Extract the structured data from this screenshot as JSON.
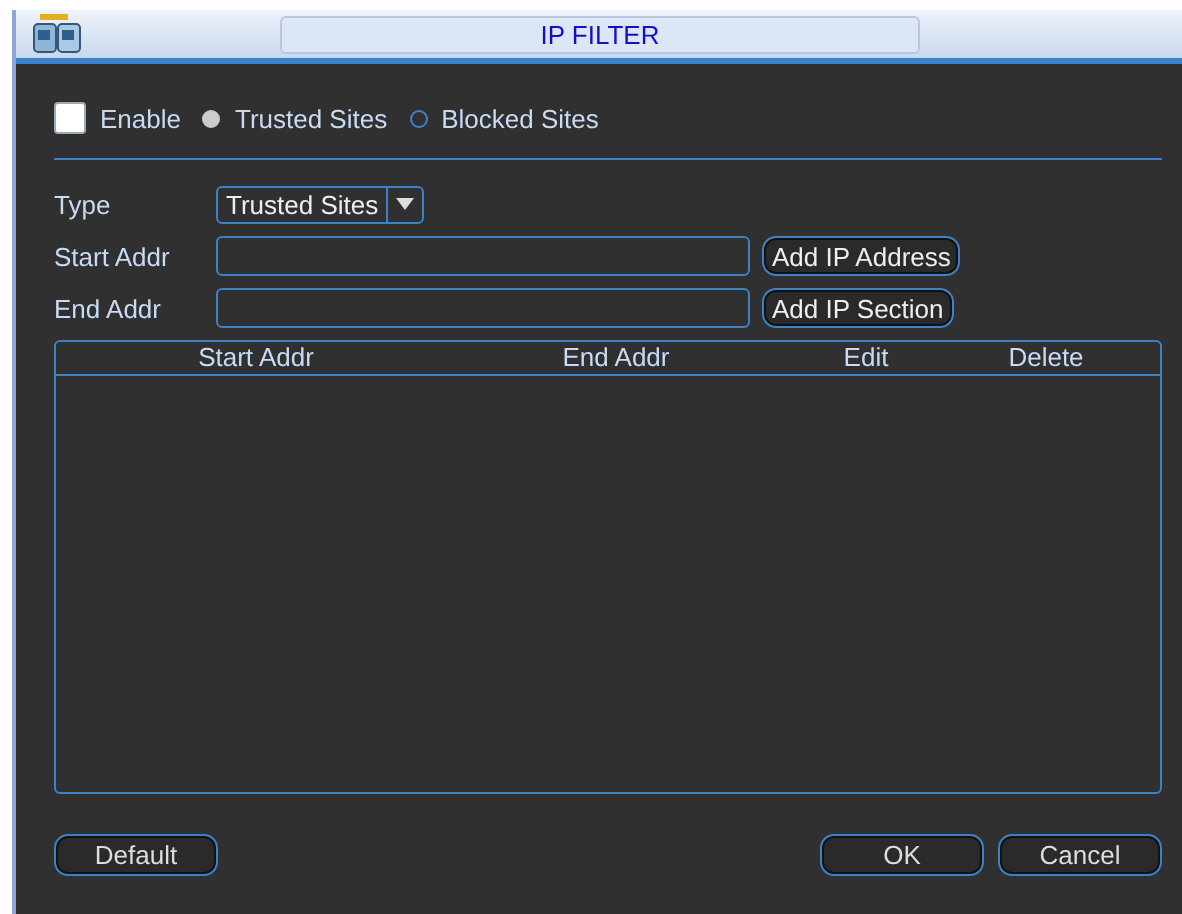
{
  "window": {
    "title": "IP FILTER"
  },
  "enable": {
    "label": "Enable",
    "checked": false
  },
  "mode_options": [
    {
      "label": "Trusted Sites",
      "selected": true
    },
    {
      "label": "Blocked Sites",
      "selected": false
    }
  ],
  "type": {
    "label": "Type",
    "value": "Trusted Sites"
  },
  "start_addr": {
    "label": "Start Addr",
    "button": "Add IP Address"
  },
  "end_addr": {
    "label": "End Addr",
    "button": "Add IP Section"
  },
  "table": {
    "columns": [
      "Start Addr",
      "End Addr",
      "Edit",
      "Delete"
    ]
  },
  "buttons": {
    "default": "Default",
    "ok": "OK",
    "cancel": "Cancel"
  }
}
